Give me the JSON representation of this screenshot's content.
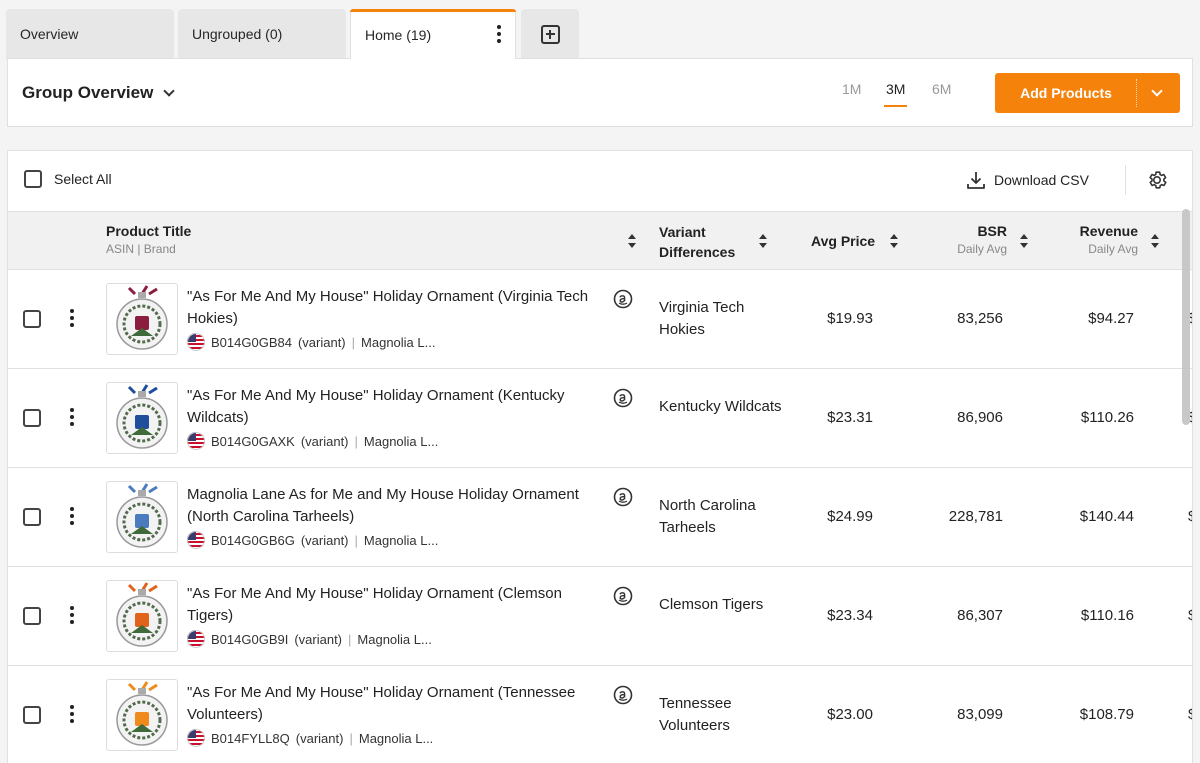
{
  "tabs": [
    {
      "label": "Overview"
    },
    {
      "label": "Ungrouped (0)"
    },
    {
      "label": "Home (19)"
    }
  ],
  "group": {
    "title": "Group Overview",
    "periods": [
      "1M",
      "3M",
      "6M"
    ],
    "selected_period": "3M",
    "add_button": "Add Products"
  },
  "toolbar": {
    "select_all": "Select All",
    "download": "Download CSV"
  },
  "columns": {
    "product_title": "Product Title",
    "product_sub": "ASIN | Brand",
    "variant": "Variant Differences",
    "avg_price": "Avg Price",
    "bsr": "BSR",
    "bsr_sub": "Daily Avg",
    "revenue": "Revenue",
    "revenue_sub": "Daily Avg"
  },
  "rows": [
    {
      "title": "\"As For Me And My House\" Holiday Ornament (Virginia Tech Hokies)",
      "asin": "B014G0GB84",
      "tag": "(variant)",
      "brand": "Magnolia L...",
      "variant": "Virginia Tech Hokies",
      "price": "$19.93",
      "bsr": "83,256",
      "revenue": "$94.27",
      "accent": "#8b1e3f"
    },
    {
      "title": "\"As For Me And My House\" Holiday Ornament (Kentucky Wildcats)",
      "asin": "B014G0GAXK",
      "tag": "(variant)",
      "brand": "Magnolia L...",
      "variant": "Kentucky Wildcats",
      "price": "$23.31",
      "bsr": "86,906",
      "revenue": "$110.26",
      "accent": "#1f4e9c"
    },
    {
      "title": "Magnolia Lane As for Me and My House Holiday Ornament (North Carolina Tarheels)",
      "asin": "B014G0GB6G",
      "tag": "(variant)",
      "brand": "Magnolia L...",
      "variant": "North Carolina Tarheels",
      "price": "$24.99",
      "bsr": "228,781",
      "revenue": "$140.44",
      "accent": "#4b7bbf"
    },
    {
      "title": "\"As For Me And My House\" Holiday Ornament (Clemson Tigers)",
      "asin": "B014G0GB9I",
      "tag": "(variant)",
      "brand": "Magnolia L...",
      "variant": "Clemson Tigers",
      "price": "$23.34",
      "bsr": "86,307",
      "revenue": "$110.16",
      "accent": "#e0621b"
    },
    {
      "title": "\"As For Me And My House\" Holiday Ornament (Tennessee Volunteers)",
      "asin": "B014FYLL8Q",
      "tag": "(variant)",
      "brand": "Magnolia L...",
      "variant": "Tennessee Volunteers",
      "price": "$23.00",
      "bsr": "83,099",
      "revenue": "$108.79",
      "accent": "#f08a1c"
    }
  ],
  "colors": {
    "accent": "#f5820b"
  }
}
